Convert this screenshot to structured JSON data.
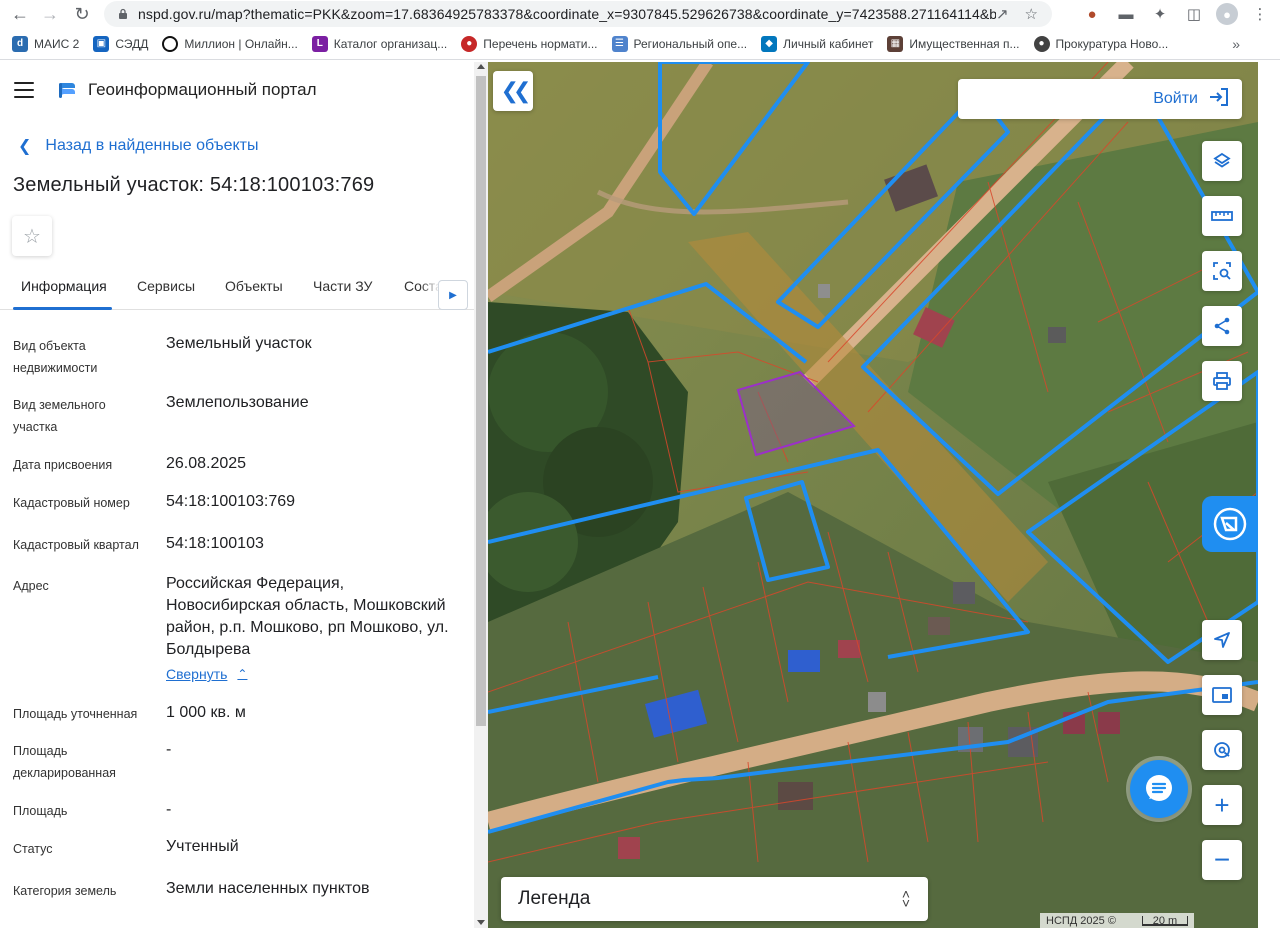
{
  "browser": {
    "url": "nspd.gov.ru/map?thematic=PKK&zoom=17.68364925783378&coordinate_x=9307845.529626738&coordinate_y=7423588.271164114&ba...",
    "bookmarks": [
      {
        "label": "МАИС 2",
        "color": "#2b6cb0"
      },
      {
        "label": "СЭДД",
        "color": "#1565c0"
      },
      {
        "label": "Миллион | Онлайн...",
        "color": "#111111"
      },
      {
        "label": "Каталог организац...",
        "color": "#7b1fa2"
      },
      {
        "label": "Перечень нормати...",
        "color": "#c62828"
      },
      {
        "label": "Региональный опе...",
        "color": "#4f83cc"
      },
      {
        "label": "Личный кабинет",
        "color": "#0277bd"
      },
      {
        "label": "Имущественная п...",
        "color": "#5d4037"
      },
      {
        "label": "Прокуратура Ново...",
        "color": "#424242"
      }
    ],
    "bookmarks_more": "»"
  },
  "app": {
    "title": "Геоинформационный портал",
    "back_label": "Назад в найденные объекты",
    "object_title": "Земельный участок: 54:18:100103:769",
    "tabs": [
      "Информация",
      "Сервисы",
      "Объекты",
      "Части ЗУ",
      "Соста"
    ],
    "active_tab": "Информация",
    "fields": [
      {
        "label": "Вид объекта недвижимости",
        "value": "Земельный участок"
      },
      {
        "label": "Вид земельного участка",
        "value": "Землепользование"
      },
      {
        "label": "Дата присвоения",
        "value": "26.08.2025"
      },
      {
        "label": "Кадастровый номер",
        "value": "54:18:100103:769"
      },
      {
        "label": "Кадастровый квартал",
        "value": "54:18:100103"
      },
      {
        "label": "Адрес",
        "value": "Российская Федерация, Новосибирская область, Мошковский район, р.п. Мошково, рп Мошково, ул. Болдырева"
      },
      {
        "label": "Площадь уточненная",
        "value": "1 000 кв. м"
      },
      {
        "label": "Площадь декларированная",
        "value": "-"
      },
      {
        "label": "Площадь",
        "value": "-"
      },
      {
        "label": "Статус",
        "value": "Учтенный"
      },
      {
        "label": "Категория земель",
        "value": "Земли населенных пунктов"
      }
    ],
    "collapse_label": "Свернуть"
  },
  "map": {
    "login_label": "Войти",
    "legend_title": "Легенда",
    "attribution": "НСПД 2025 ©",
    "scale_label": "20 m",
    "colors": {
      "parcel_outline": "#1f8ef1",
      "selected_parcel": "#9b30c9",
      "cadastre_lines": "#d9472b",
      "accent": "#1f6fd1"
    }
  }
}
